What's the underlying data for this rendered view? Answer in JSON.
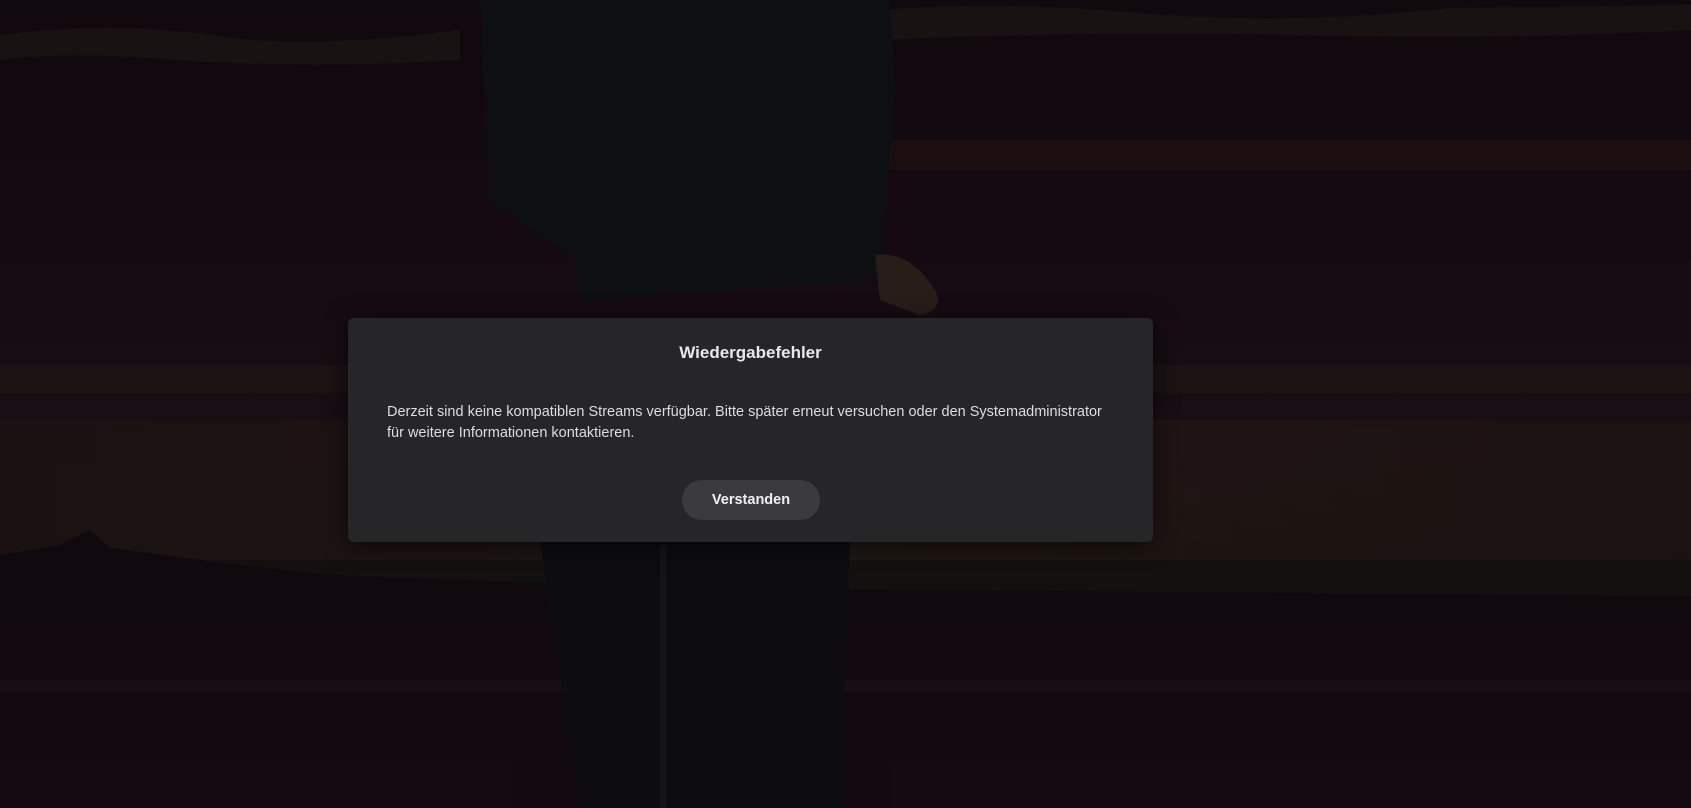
{
  "dialog": {
    "title": "Wiedergabefehler",
    "message": "Derzeit sind keine kompatiblen Streams verfügbar. Bitte später erneut versuchen oder den Systemadministrator für weitere Informationen kontaktieren.",
    "button_label": "Verstanden"
  },
  "colors": {
    "dialog_background": "#262628",
    "button_background": "#3b3b3e",
    "text": "#e9e9ea"
  }
}
